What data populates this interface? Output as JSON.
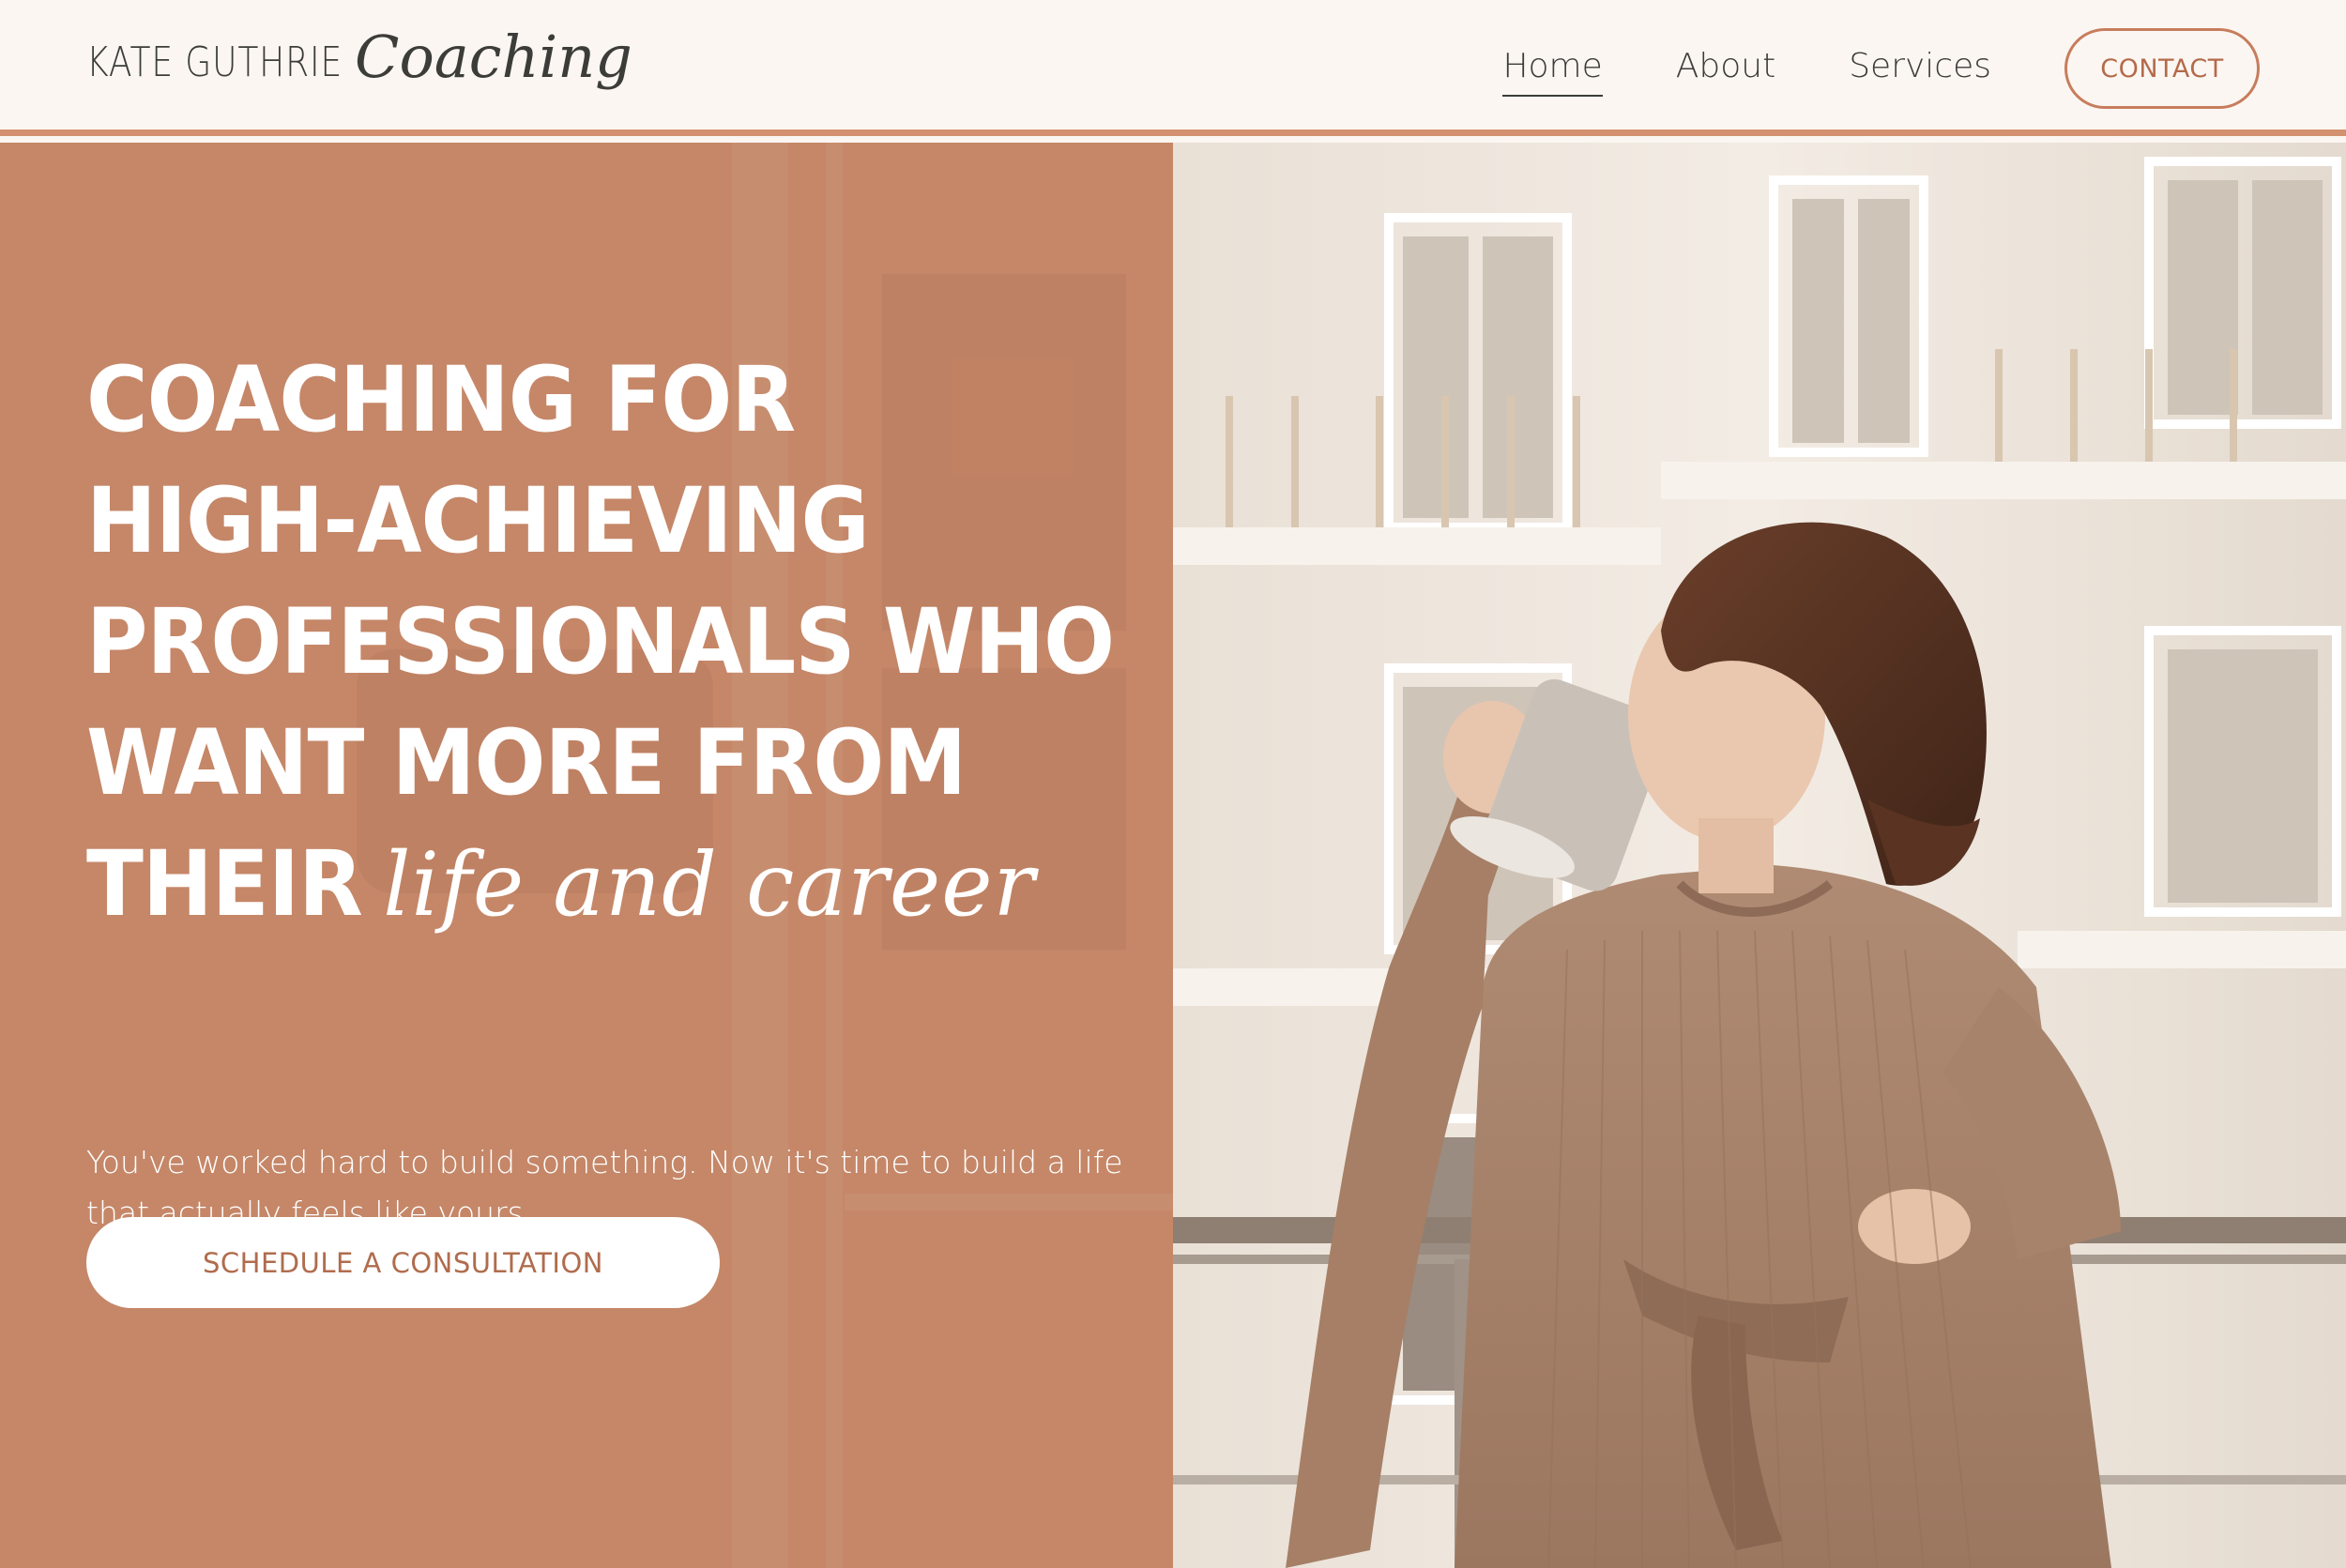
{
  "header": {
    "logo_text": "KATE GUTHRIE",
    "logo_script": "Coaching",
    "nav": [
      {
        "label": "Home",
        "active": true
      },
      {
        "label": "About",
        "active": false
      },
      {
        "label": "Services",
        "active": false
      }
    ],
    "contact_label": "CONTACT"
  },
  "hero": {
    "headline_lines": [
      "COACHING FOR",
      "HIGH-ACHIEVING",
      "PROFESSIONALS WHO",
      "WANT MORE FROM",
      "THEIR"
    ],
    "headline_script": "life and career",
    "subtext": "You've worked hard to build something. Now it's time to build a life that actually feels like yours.",
    "cta_label": "SCHEDULE A CONSULTATION",
    "photo_icon": "woman-drinking-coffee-photo"
  },
  "colors": {
    "accent": "#d49170",
    "panel": "#c58768",
    "contact_border": "#c77d5c",
    "text_dark": "#3c3c39",
    "background": "#fbf6f2"
  }
}
